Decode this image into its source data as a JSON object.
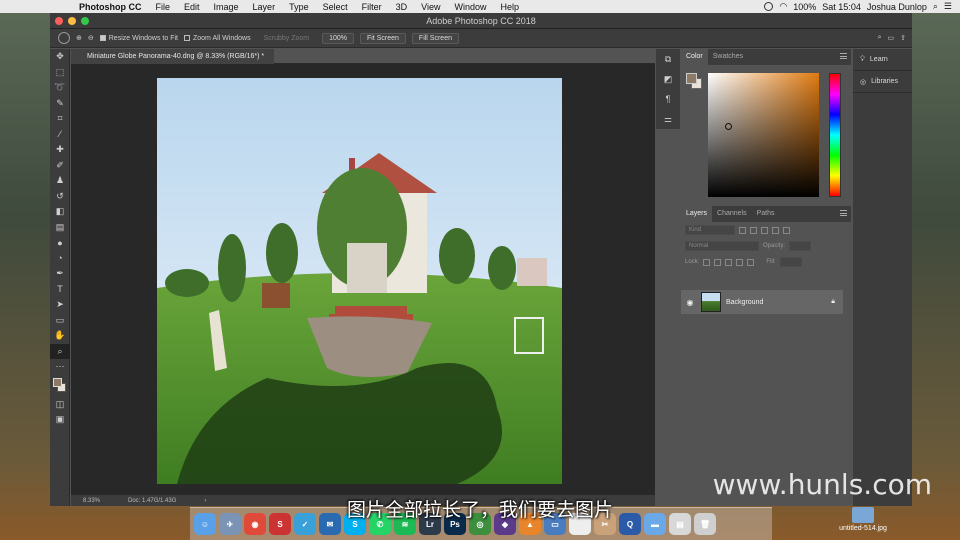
{
  "menubar": {
    "app": "Photoshop CC",
    "items": [
      "File",
      "Edit",
      "Image",
      "Layer",
      "Type",
      "Select",
      "Filter",
      "3D",
      "View",
      "Window",
      "Help"
    ],
    "battery": "100%",
    "clock": "Sat 15:04",
    "user": "Joshua Dunlop"
  },
  "window": {
    "title": "Adobe Photoshop CC 2018"
  },
  "options": {
    "resize_windows": "Resize Windows to Fit",
    "zoom_all": "Zoom All Windows",
    "scrubby": "Scrubby Zoom",
    "zoom_100": "100%",
    "fit_screen": "Fit Screen",
    "fill_screen": "Fill Screen"
  },
  "document": {
    "tab": "Miniature Globe Panorama-40.dng @ 8.33% (RGB/16*) *",
    "zoom": "8.33%",
    "doc_info": "Doc: 1.47G/1.43G"
  },
  "color_panel": {
    "tabs": [
      "Color",
      "Swatches"
    ],
    "fg_color": "#8d7a66",
    "bg_color": "#e9e2d8"
  },
  "layers_panel": {
    "tabs": [
      "Layers",
      "Channels",
      "Paths"
    ],
    "kind_placeholder": "Kind",
    "blend_mode": "Normal",
    "opacity_label": "Opacity:",
    "lock_label": "Lock:",
    "fill_label": "Fill:",
    "layers": [
      {
        "name": "Background"
      }
    ]
  },
  "side_buttons": {
    "learn": "Learn",
    "libraries": "Libraries"
  },
  "desktop_file": "untitled-514.jpg",
  "subtitle": "图片全部拉长了，我们要去图片",
  "watermark": "www.hunls.com"
}
